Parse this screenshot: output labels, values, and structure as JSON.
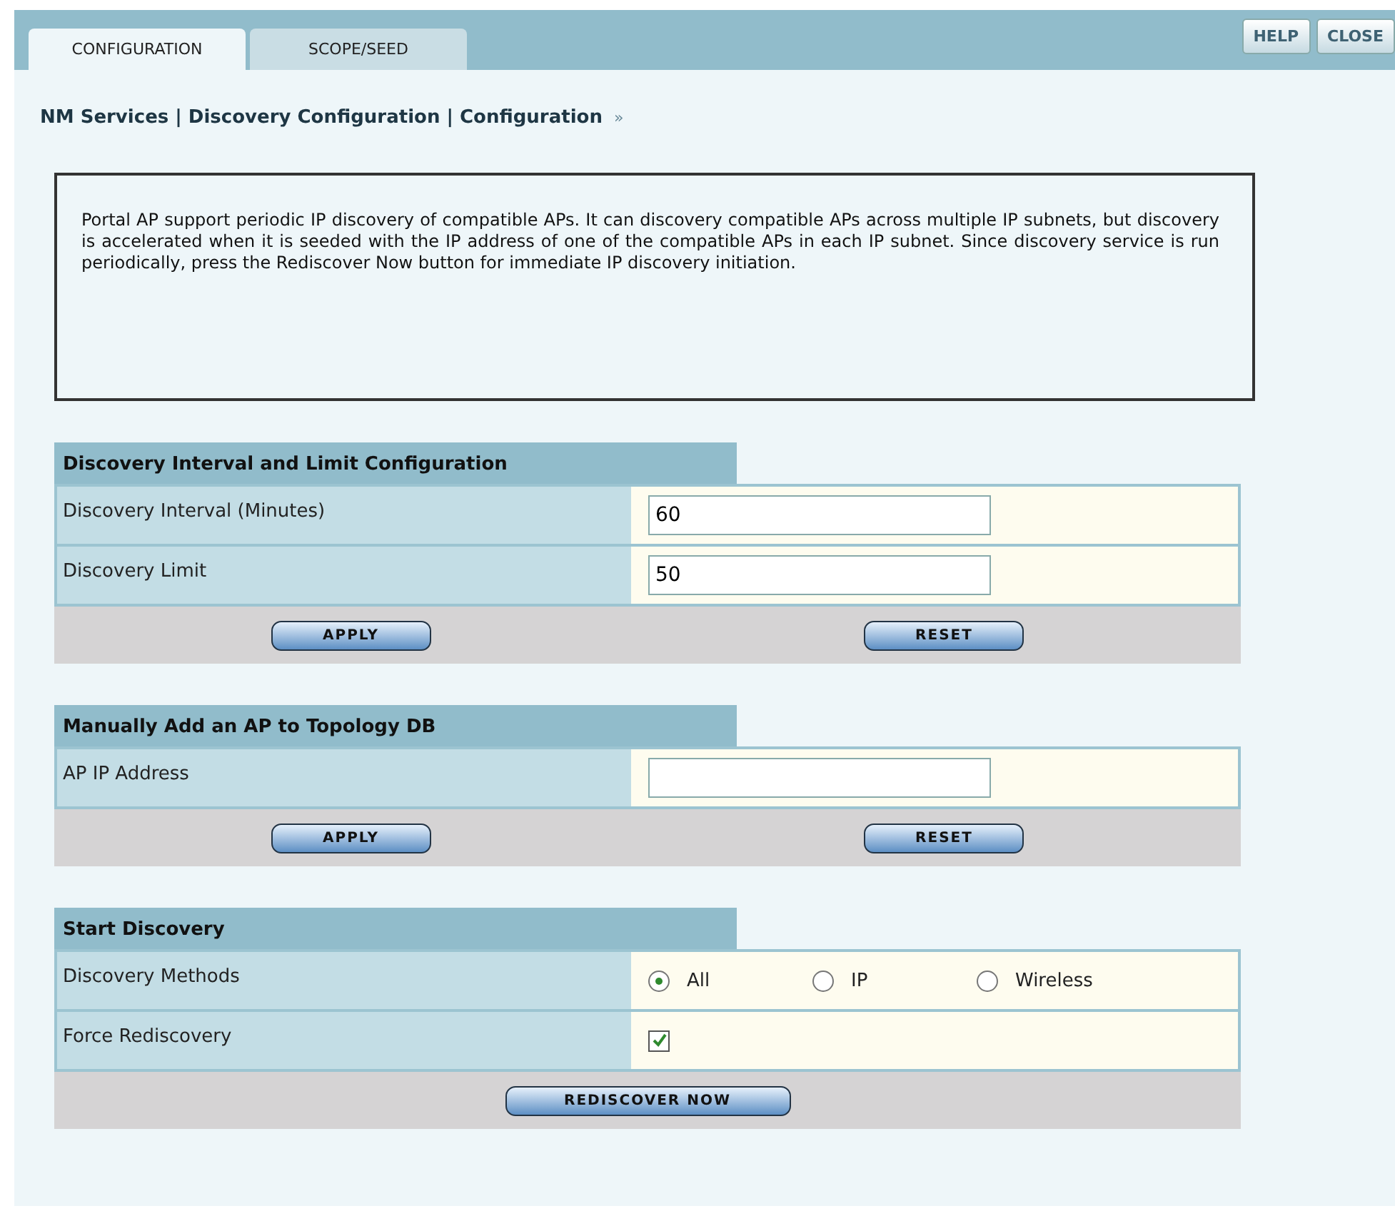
{
  "tabs": [
    {
      "label": "CONFIGURATION",
      "selected": true
    },
    {
      "label": "SCOPE/SEED",
      "selected": false
    }
  ],
  "top_buttons": [
    "HELP",
    "CLOSE"
  ],
  "breadcrumb": "NM Services | Discovery Configuration | Configuration",
  "breadcrumb_arrow": "»",
  "info": "Portal AP support periodic IP discovery of compatible APs. It can discovery compatible APs across multiple IP subnets, but discovery is accelerated when it is seeded with the IP address of one of the compatible APs in each IP subnet. Since discovery service is run periodically, press the Rediscover Now button for immediate IP discovery initiation.",
  "sections": [
    {
      "title": "Discovery Interval and Limit Configuration",
      "rows": [
        {
          "kind": "text",
          "label": "Discovery Interval (Minutes)",
          "value": "60"
        },
        {
          "kind": "text",
          "label": "Discovery Limit",
          "value": "50"
        }
      ],
      "buttons": [
        "APPLY",
        "RESET"
      ]
    },
    {
      "title": "Manually Add an AP to Topology DB",
      "rows": [
        {
          "kind": "text",
          "label": "AP IP Address"
        }
      ],
      "buttons": [
        "APPLY",
        "RESET"
      ]
    },
    {
      "title": "Start Discovery",
      "rows": [
        {
          "kind": "radio",
          "label": "Discovery Methods",
          "options": [
            {
              "label": "All",
              "selected": true
            },
            {
              "label": "IP",
              "selected": false
            },
            {
              "label": "Wireless",
              "selected": false
            }
          ]
        },
        {
          "kind": "checkbox",
          "label": "Force Rediscovery",
          "checked": true
        }
      ],
      "buttons": [
        "REDISCOVER NOW"
      ]
    }
  ]
}
